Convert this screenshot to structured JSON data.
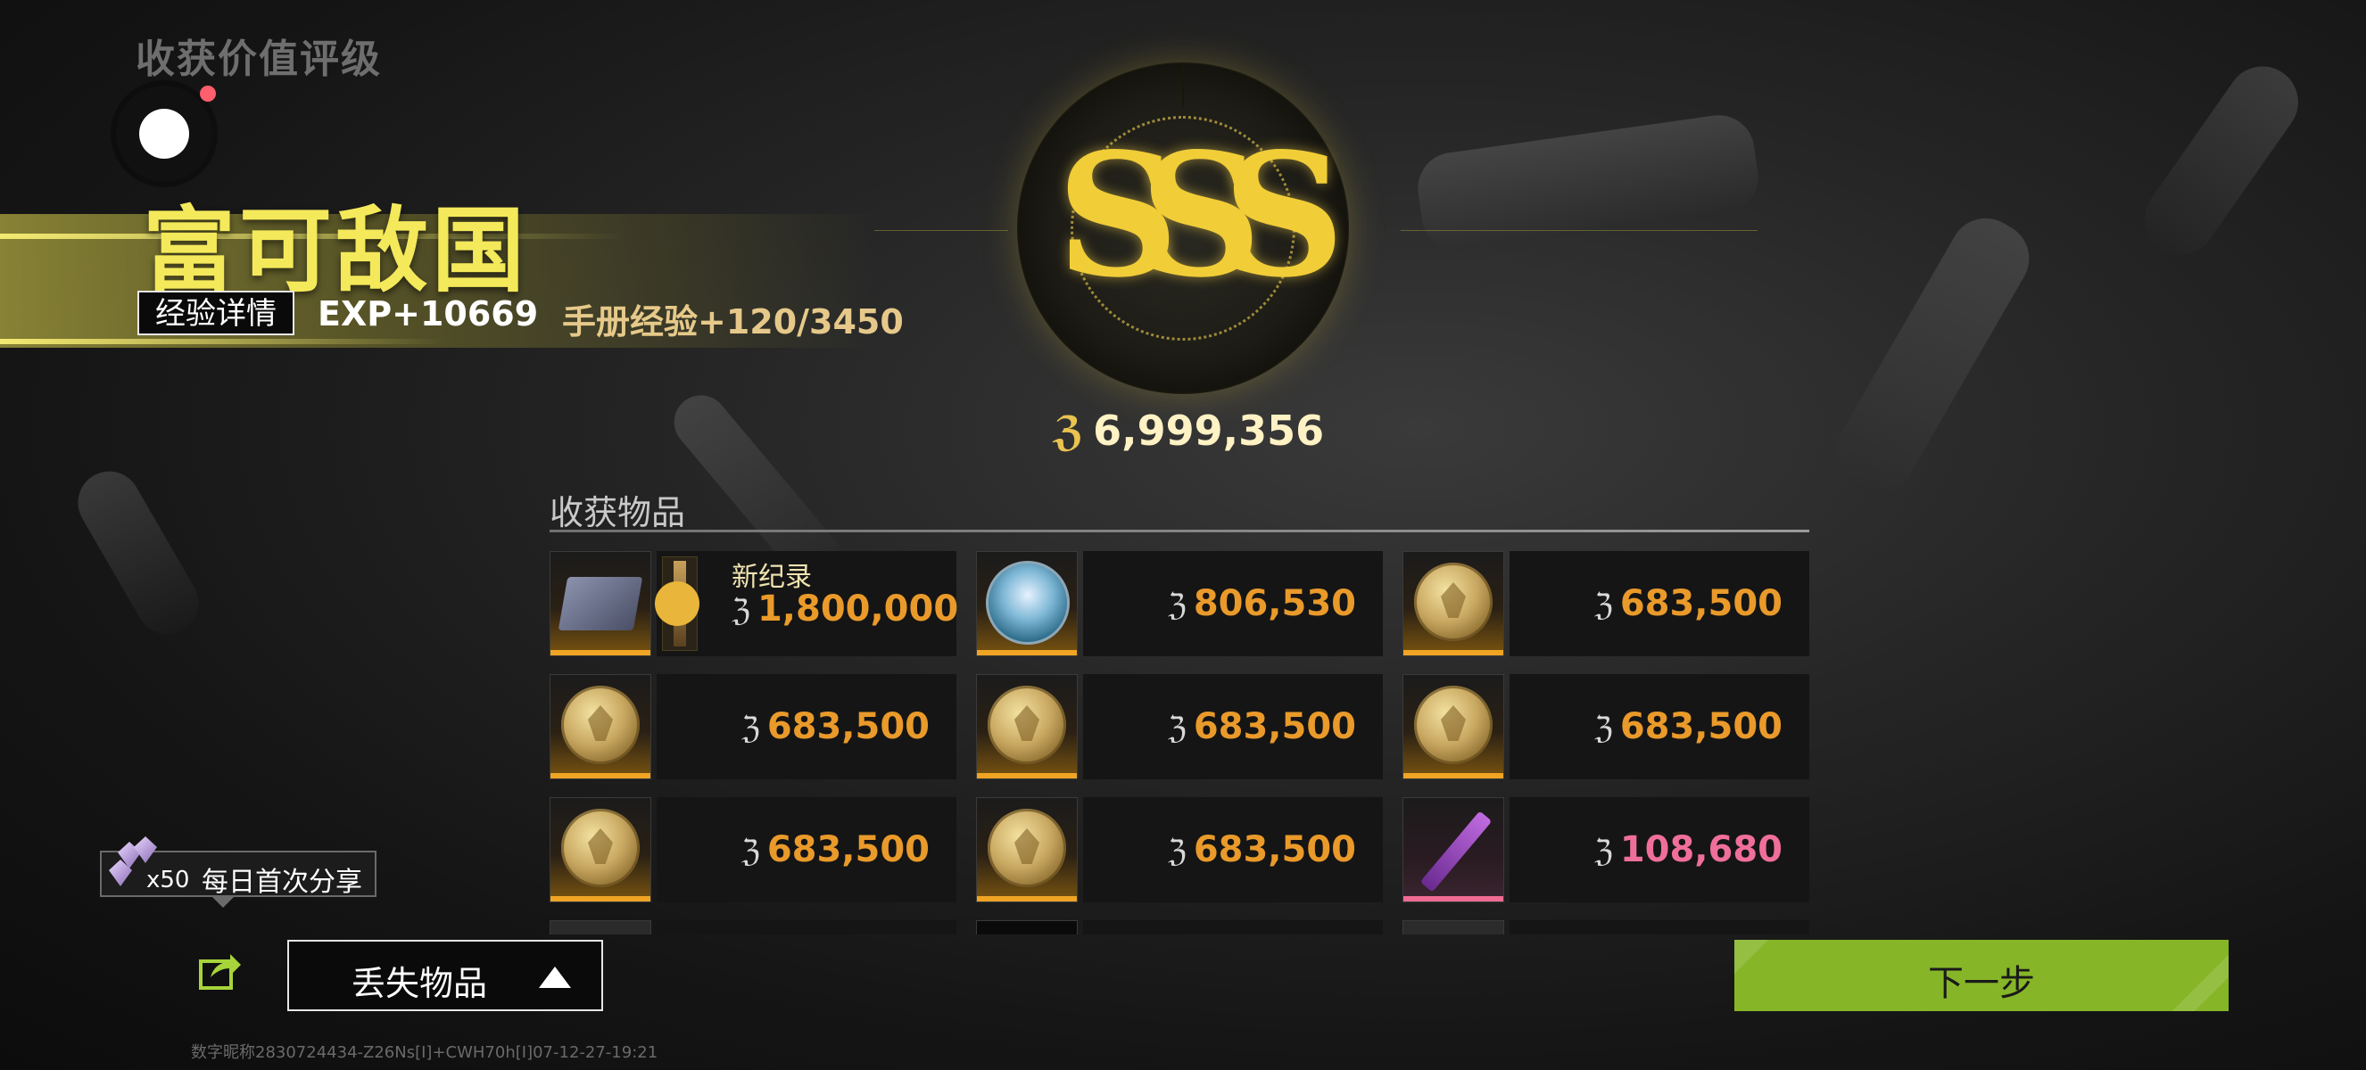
{
  "header": {
    "section_title": "收获价值评级",
    "grade_title": "富可敌国",
    "exp_detail_button": "经验详情",
    "exp_value": "EXP+10669",
    "manual_exp": "手册经验+120/3450"
  },
  "grade_badge": {
    "letters": "SSS",
    "total_value": "6,999,356",
    "currency_symbol": "ℨ"
  },
  "items_section": {
    "label": "收获物品",
    "items": [
      {
        "thumb": "wallet-icon",
        "price": "1,800,000",
        "new_record": "新纪录",
        "rarity": "gold"
      },
      {
        "thumb": "temple-coin-icon",
        "price": "806,530",
        "rarity": "gold"
      },
      {
        "thumb": "gold-coin-icon",
        "price": "683,500",
        "rarity": "gold"
      },
      {
        "thumb": "gold-coin-icon",
        "price": "683,500",
        "rarity": "gold"
      },
      {
        "thumb": "gold-coin-icon",
        "price": "683,500",
        "rarity": "gold"
      },
      {
        "thumb": "gold-coin-icon",
        "price": "683,500",
        "rarity": "gold"
      },
      {
        "thumb": "gold-coin-icon",
        "price": "683,500",
        "rarity": "gold"
      },
      {
        "thumb": "gold-coin-icon",
        "price": "683,500",
        "rarity": "gold"
      },
      {
        "thumb": "syringe-icon",
        "price": "108,680",
        "rarity": "pink"
      }
    ]
  },
  "share": {
    "count": "x50",
    "label": "每日首次分享"
  },
  "lost_items_button": "丢失物品",
  "next_button": "下一步",
  "footer_text": "数字昵称2830724434-Z26Ns[I]+CWH70h[I]07-12-27-19:21",
  "colors": {
    "accent_gold": "#f4e95a",
    "price_orange": "#e99a2a",
    "price_pink": "#ef6f9a",
    "next_green": "#86b628"
  }
}
